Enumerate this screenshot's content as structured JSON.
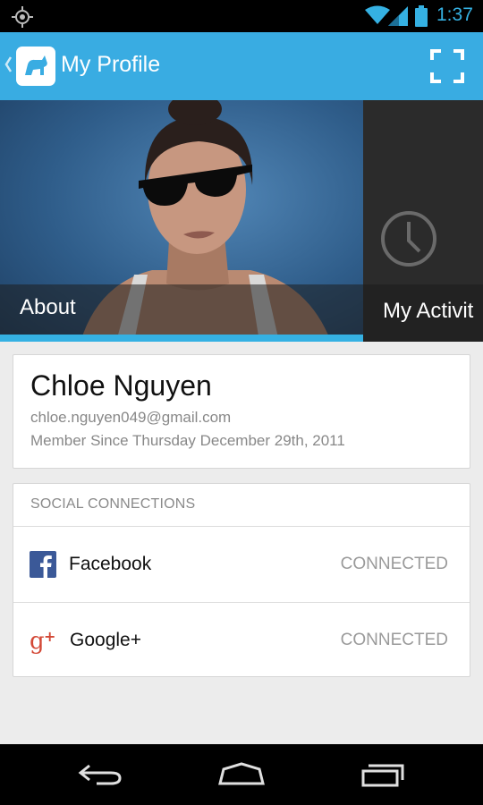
{
  "status_bar": {
    "time": "1:37",
    "icons": [
      "gps-icon",
      "wifi-icon",
      "signal-icon",
      "battery-icon"
    ],
    "clock_color": "#35b1e3"
  },
  "action_bar": {
    "title": "My Profile",
    "background": "#39ace2",
    "icons": [
      "up-caret-icon",
      "app-logo-icon",
      "fullscreen-icon"
    ]
  },
  "tabs": [
    {
      "label": "About",
      "selected": true
    },
    {
      "label": "My Activit",
      "selected": false,
      "icon": "clock-icon"
    }
  ],
  "profile": {
    "name": "Chloe Nguyen",
    "email": "chloe.nguyen049@gmail.com",
    "member_since": "Member Since Thursday December 29th, 2011"
  },
  "social": {
    "header": "SOCIAL CONNECTIONS",
    "items": [
      {
        "name": "Facebook",
        "status": "CONNECTED",
        "icon": "facebook-icon",
        "color": "#3b5998"
      },
      {
        "name": "Google+",
        "status": "CONNECTED",
        "icon": "google-plus-icon",
        "color": "#d34836"
      }
    ]
  },
  "nav_bar": {
    "buttons": [
      "back-icon",
      "home-icon",
      "recent-apps-icon"
    ]
  }
}
